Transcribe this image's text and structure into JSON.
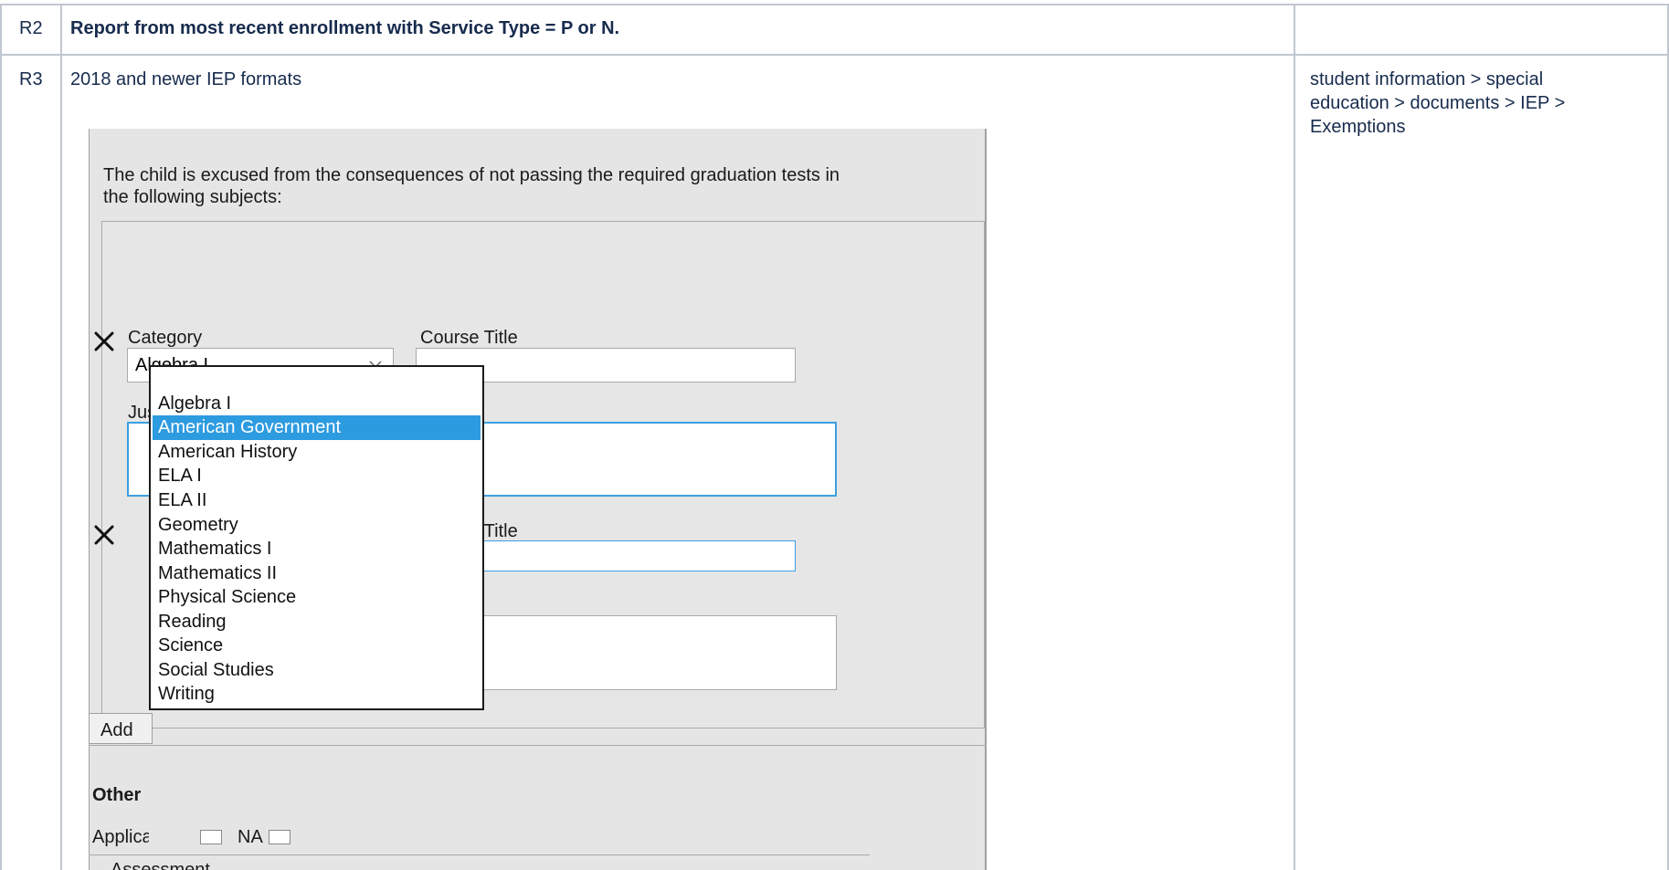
{
  "rows": [
    {
      "id": "R2",
      "description": "Report from most recent enrollment with Service Type = P or N.",
      "path": ""
    },
    {
      "id": "R3",
      "description": "2018 and newer IEP formats",
      "path_lines": [
        "student information > special",
        "education > documents > IEP >",
        "Exemptions"
      ]
    }
  ],
  "screenshot": {
    "intro_lines": [
      "The child is excused from the consequences of not passing the required graduation tests in",
      "the following subjects:"
    ],
    "exemption1": {
      "category_label": "Category",
      "category_value": "Algebra I",
      "course_title_label": "Course Title",
      "course_title_value": "",
      "justification_label": "Justification",
      "justification_value": ""
    },
    "exemption2": {
      "course_title_label": "Course Title",
      "course_title_value": ""
    },
    "add_button_label": "Add",
    "other_label": "Other",
    "applicable_label": "Applicable",
    "na_label": "NA",
    "assessment_label": "Assessment",
    "category_options": [
      "Algebra I",
      "American Government",
      "American History",
      "ELA I",
      "ELA II",
      "Geometry",
      "Mathematics I",
      "Mathematics II",
      "Physical Science",
      "Reading",
      "Science",
      "Social Studies",
      "Writing"
    ],
    "selected_option": "American Government"
  },
  "colors": {
    "table_border": "#c1c7d0",
    "panel_bg": "#e5e5e5",
    "focus_blue": "#3c9fe0",
    "highlight_blue": "#2d9be0"
  }
}
